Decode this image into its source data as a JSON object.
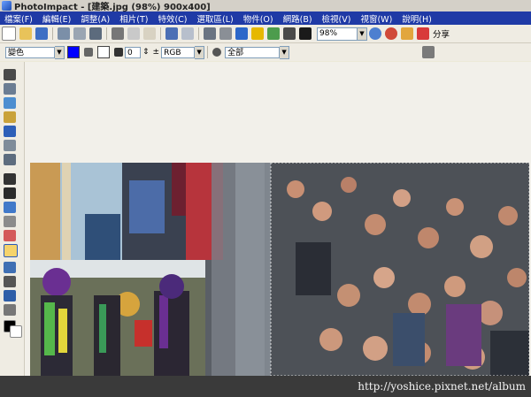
{
  "window": {
    "title": "PhotoImpact - [建築.jpg (98%) 900x400]"
  },
  "menu": [
    "檔案(F)",
    "編輯(E)",
    "調整(A)",
    "相片(T)",
    "特效(C)",
    "選取區(L)",
    "物件(O)",
    "網路(B)",
    "檢視(V)",
    "視窗(W)",
    "說明(H)"
  ],
  "toolbar": {
    "zoom_value": "98%",
    "share_label": "分享"
  },
  "attributes": {
    "mode_value": "變色",
    "number_value": "0",
    "color_model": "RGB",
    "scope_value": "全部"
  },
  "colors": {
    "menubar": "#1f3aa6",
    "foreground": "#0000ff",
    "background": "#ffffff"
  },
  "watermark": "http://yoshice.pixnet.net/album"
}
